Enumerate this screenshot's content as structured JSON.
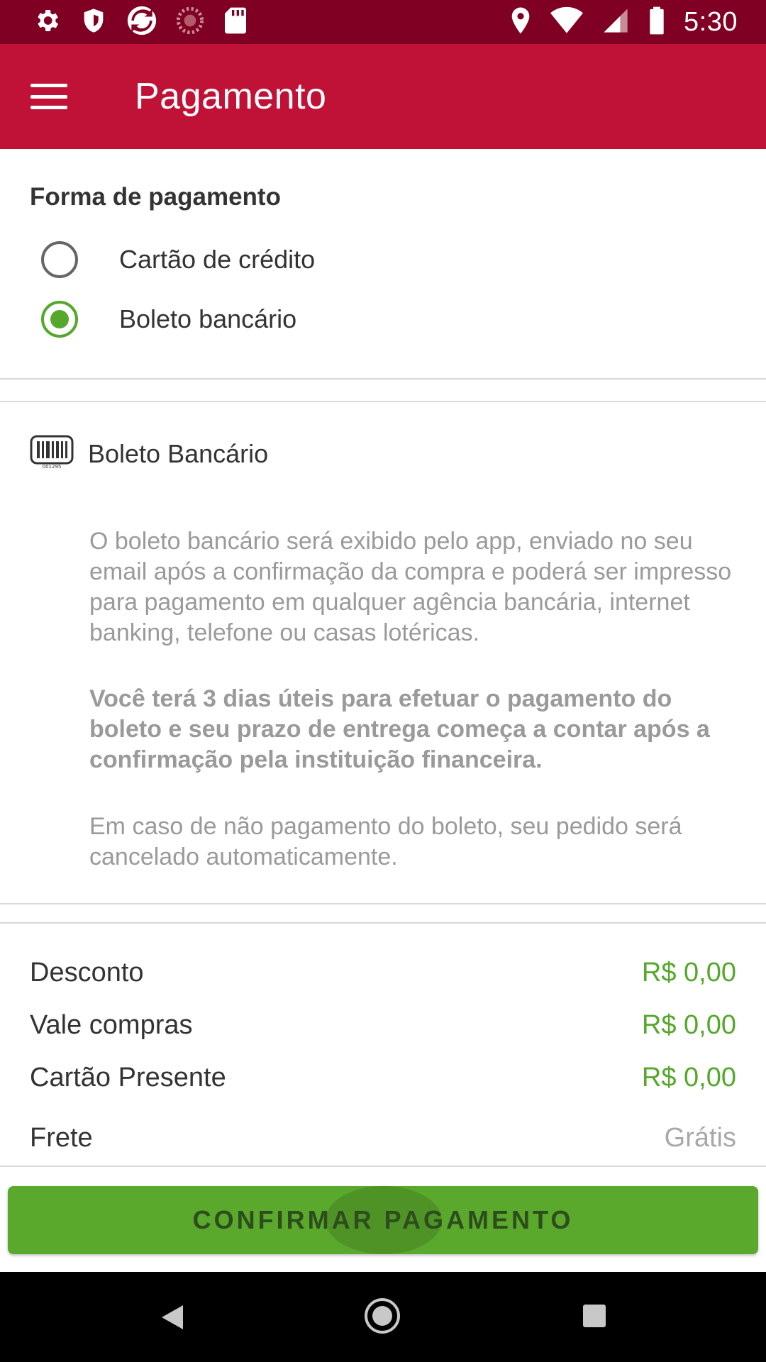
{
  "status_bar": {
    "time": "5:30",
    "left_icons": [
      "settings-icon",
      "shield-icon",
      "sync-icon",
      "loading-icon",
      "sd-card-icon"
    ],
    "right_icons": [
      "location-icon",
      "wifi-icon",
      "signal-icon",
      "battery-icon"
    ]
  },
  "app_bar": {
    "title": "Pagamento",
    "menu_icon": "menu-icon",
    "color": "#c01237"
  },
  "payment_method": {
    "title": "Forma de pagamento",
    "options": [
      {
        "label": "Cartão de crédito",
        "selected": false
      },
      {
        "label": "Boleto bancário",
        "selected": true
      }
    ]
  },
  "boleto": {
    "icon": "barcode-icon",
    "barcode_caption": "001295",
    "title": "Boleto Bancário",
    "paragraph1": "O boleto bancário será exibido pelo app, enviado no seu email após a confirmação da compra e poderá ser impresso para pagamento em qualquer agência bancária, internet banking, telefone ou casas lotéricas.",
    "paragraph2": "Você terá 3 dias úteis para efetuar o pagamento do boleto e seu prazo de entrega começa a contar após a confirmação pela instituição financeira.",
    "paragraph3": "Em caso de não pagamento do boleto, seu pedido será cancelado automaticamente."
  },
  "summary": {
    "rows": [
      {
        "label": "Desconto",
        "value": "R$ 0,00"
      },
      {
        "label": "Vale compras",
        "value": "R$ 0,00"
      },
      {
        "label": "Cartão Presente",
        "value": "R$ 0,00"
      },
      {
        "label": "Frete",
        "value": "Grátis"
      }
    ]
  },
  "confirm_button": {
    "label": "CONFIRMAR PAGAMENTO",
    "color": "#5aa82c"
  },
  "nav_bar": {
    "icons": [
      "back-icon",
      "home-icon",
      "recents-icon"
    ]
  }
}
